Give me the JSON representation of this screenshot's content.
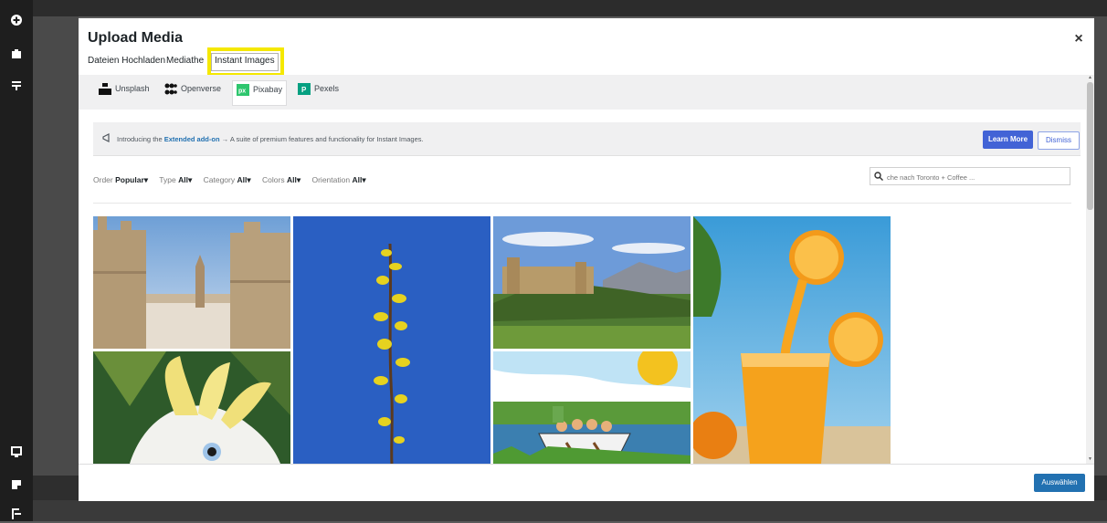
{
  "modal": {
    "title": "Upload Media",
    "close_label": "×"
  },
  "tabs": [
    {
      "label": "Dateien Hochladen"
    },
    {
      "label": "Mediathe"
    },
    {
      "label": "Instant Images",
      "active": true
    }
  ],
  "providers": [
    {
      "label": "Unsplash",
      "icon": "unsplash-icon"
    },
    {
      "label": "Openverse",
      "icon": "openverse-icon"
    },
    {
      "label": "Pixabay",
      "icon": "pixabay-icon",
      "active": true
    },
    {
      "label": "Pexels",
      "icon": "pexels-icon"
    }
  ],
  "notice": {
    "prefix": "Introducing the",
    "link": "Extended add-on",
    "suffix": "→ A suite of premium features and functionality for Instant Images.",
    "learn_more": "Learn More",
    "dismiss": "Dismiss"
  },
  "filters": {
    "order_label": "Order",
    "order_value": "Popular",
    "type_label": "Type",
    "type_value": "All",
    "category_label": "Category",
    "category_value": "All",
    "colors_label": "Colors",
    "colors_value": "All",
    "orientation_label": "Orientation",
    "orientation_value": "All"
  },
  "search": {
    "placeholder": "che nach Toronto + Coffee ..."
  },
  "images": [
    {
      "name": "town-between-towers"
    },
    {
      "name": "yellow-flower-branch"
    },
    {
      "name": "castle-on-hill"
    },
    {
      "name": "orange-juice"
    },
    {
      "name": "cockatoo"
    },
    {
      "name": "cartoon-boat-rowing"
    }
  ],
  "footer": {
    "select_label": "Auswählen"
  },
  "colors": {
    "accent": "#2271b1",
    "learn_more_bg": "#4263d6",
    "highlight": "#f5e800",
    "sidebar": "#1e1e1e"
  }
}
